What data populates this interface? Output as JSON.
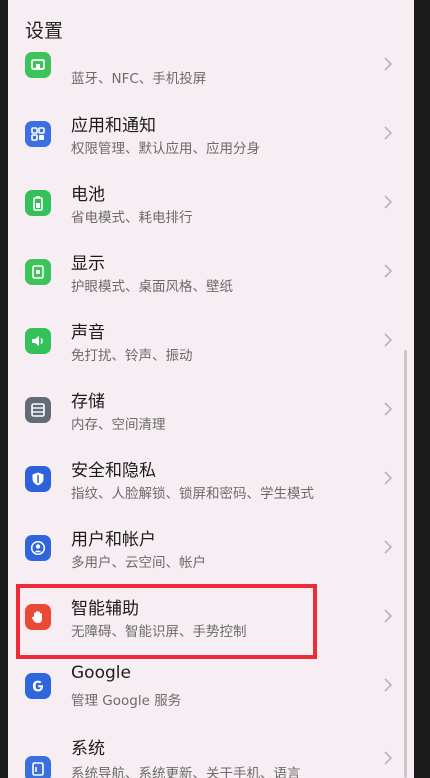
{
  "header": {
    "title": "设置"
  },
  "items": [
    {
      "title": "",
      "subtitle": "蓝牙、NFC、手机投屏",
      "icon": "devices-icon",
      "color": "#3cc35a"
    },
    {
      "title": "应用和通知",
      "subtitle": "权限管理、默认应用、应用分身",
      "icon": "apps-icon",
      "color": "#3d6fe3"
    },
    {
      "title": "电池",
      "subtitle": "省电模式、耗电排行",
      "icon": "battery-icon",
      "color": "#35c15a"
    },
    {
      "title": "显示",
      "subtitle": "护眼模式、桌面风格、壁纸",
      "icon": "display-icon",
      "color": "#3cc35a"
    },
    {
      "title": "声音",
      "subtitle": "免打扰、铃声、振动",
      "icon": "sound-icon",
      "color": "#35c15a"
    },
    {
      "title": "存储",
      "subtitle": "内存、空间清理",
      "icon": "storage-icon",
      "color": "#636b76"
    },
    {
      "title": "安全和隐私",
      "subtitle": "指纹、人脸解锁、锁屏和密码、学生模式",
      "icon": "shield-icon",
      "color": "#2d62dc"
    },
    {
      "title": "用户和帐户",
      "subtitle": "多用户、云空间、帐户",
      "icon": "user-icon",
      "color": "#2f66de"
    },
    {
      "title": "智能辅助",
      "subtitle": "无障碍、智能识屏、手势控制",
      "icon": "hand-icon",
      "color": "#ea4a35"
    },
    {
      "title": "Google",
      "subtitle": "管理 Google 服务",
      "icon": "google-icon",
      "color": "#2f66de"
    },
    {
      "title": "系统",
      "subtitle": "系统导航、系统更新、关于手机、语言",
      "icon": "system-icon",
      "color": "#3a6fe0"
    }
  ]
}
